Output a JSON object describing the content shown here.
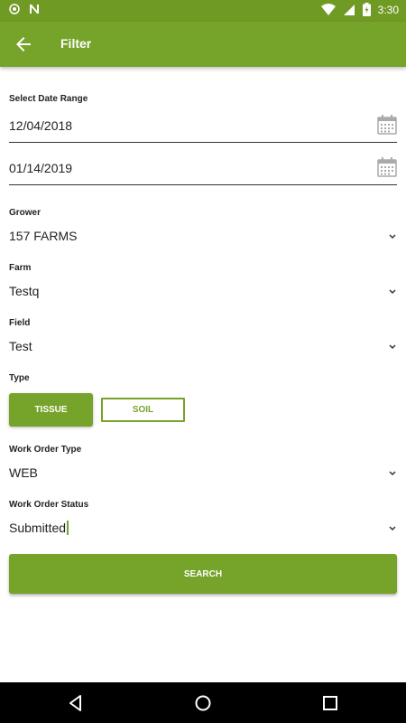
{
  "status_bar": {
    "time": "3:30"
  },
  "app_bar": {
    "title": "Filter"
  },
  "date_range": {
    "label": "Select Date Range",
    "start": "12/04/2018",
    "end": "01/14/2019"
  },
  "grower": {
    "label": "Grower",
    "value": "157 FARMS"
  },
  "farm": {
    "label": "Farm",
    "value": "Testq"
  },
  "field": {
    "label": "Field",
    "value": "Test"
  },
  "type": {
    "label": "Type",
    "options": [
      "TISSUE",
      "SOIL"
    ],
    "selected": "TISSUE"
  },
  "work_order_type": {
    "label": "Work Order Type",
    "value": "WEB"
  },
  "work_order_status": {
    "label": "Work Order Status",
    "value": "Submitted"
  },
  "search_button": {
    "label": "SEARCH"
  },
  "colors": {
    "primary": "#76a32a",
    "status_bar": "#6f9a24"
  }
}
